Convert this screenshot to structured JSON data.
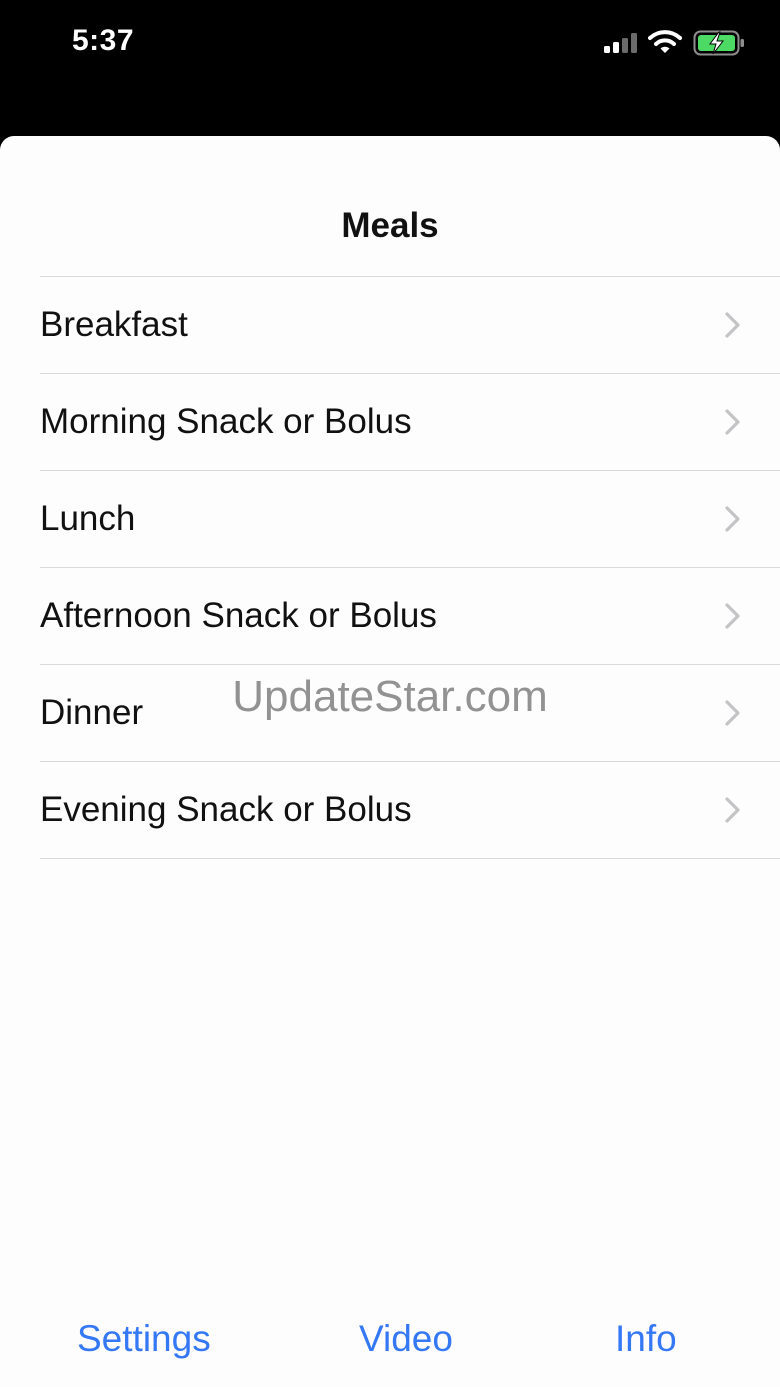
{
  "status_bar": {
    "time": "5:37",
    "icons": [
      "signal-icon",
      "wifi-icon",
      "battery-charging-icon"
    ],
    "battery_color": "#4cd964"
  },
  "nav": {
    "title": "Meals"
  },
  "meals": {
    "items": [
      {
        "label": "Breakfast",
        "icon": "chevron-right-icon"
      },
      {
        "label": "Morning Snack or Bolus",
        "icon": "chevron-right-icon"
      },
      {
        "label": "Lunch",
        "icon": "chevron-right-icon"
      },
      {
        "label": "Afternoon Snack or Bolus",
        "icon": "chevron-right-icon"
      },
      {
        "label": "Dinner",
        "icon": "chevron-right-icon"
      },
      {
        "label": "Evening Snack or Bolus",
        "icon": "chevron-right-icon"
      }
    ]
  },
  "watermark": {
    "text": "UpdateStar.com"
  },
  "bottom_bar": {
    "settings_label": "Settings",
    "video_label": "Video",
    "info_label": "Info",
    "accent_color": "#3478f6"
  }
}
